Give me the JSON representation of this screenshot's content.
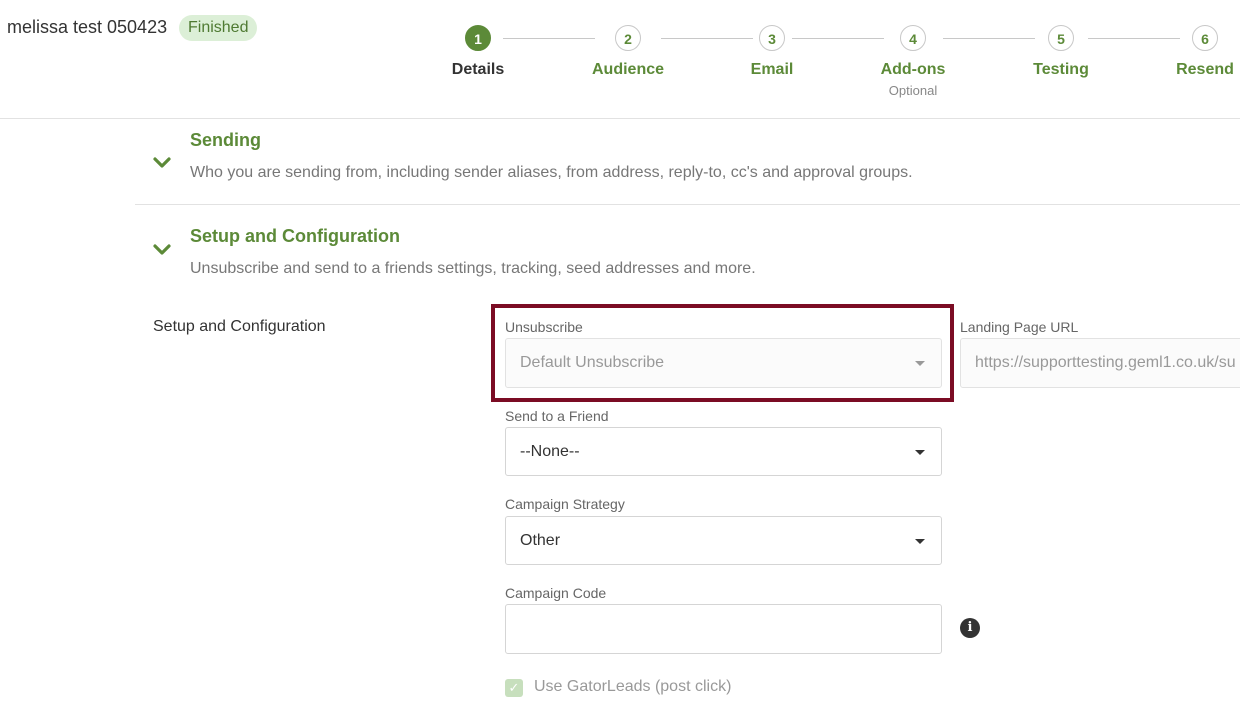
{
  "campaign": {
    "name": "melissa test 050423",
    "status": "Finished"
  },
  "steps": [
    {
      "number": "1",
      "label": "Details",
      "sub": ""
    },
    {
      "number": "2",
      "label": "Audience",
      "sub": ""
    },
    {
      "number": "3",
      "label": "Email",
      "sub": ""
    },
    {
      "number": "4",
      "label": "Add-ons",
      "sub": "Optional"
    },
    {
      "number": "5",
      "label": "Testing",
      "sub": ""
    },
    {
      "number": "6",
      "label": "Resend",
      "sub": ""
    }
  ],
  "active_step": "1",
  "sections": {
    "sending": {
      "title": "Sending",
      "description": "Who you are sending from, including sender aliases, from address, reply-to, cc's and approval groups."
    },
    "setup": {
      "title": "Setup and Configuration",
      "description": "Unsubscribe and send to a friends settings, tracking, seed addresses and more."
    }
  },
  "form": {
    "row_label": "Setup and Configuration",
    "unsubscribe": {
      "label": "Unsubscribe",
      "value": "Default Unsubscribe"
    },
    "landing_page": {
      "label": "Landing Page URL",
      "placeholder": "https://supporttesting.geml1.co.uk/su"
    },
    "send_to_friend": {
      "label": "Send to a Friend",
      "value": "--None--"
    },
    "campaign_strategy": {
      "label": "Campaign Strategy",
      "value": "Other"
    },
    "campaign_code": {
      "label": "Campaign Code",
      "value": ""
    },
    "gatorleads": {
      "label": "Use GatorLeads (post click)",
      "checked": true
    }
  },
  "colors": {
    "brand_green": "#5c8a38",
    "highlight": "#7b0c24",
    "badge_bg": "#dcefd7"
  }
}
